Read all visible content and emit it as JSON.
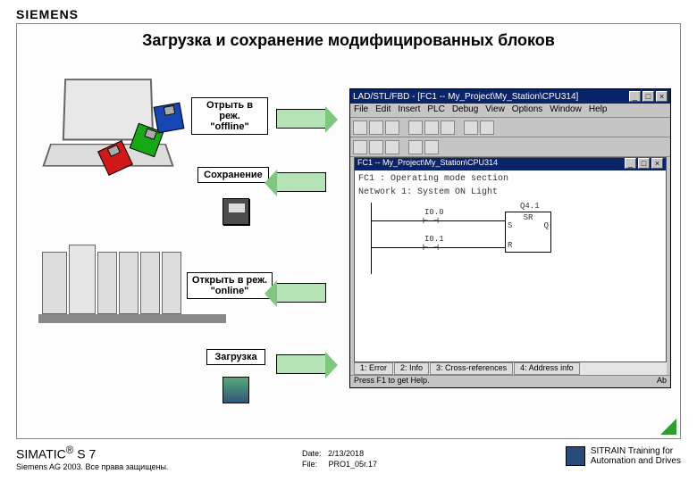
{
  "brand": "SIEMENS",
  "title": "Загрузка и сохранение модифицированных блоков",
  "labels": {
    "open_offline": "Отрыть в реж.\n\"offline\"",
    "save": "Сохранение",
    "open_online": "Открыть в реж.\n\"online\"",
    "download": "Загрузка"
  },
  "editor": {
    "title": "LAD/STL/FBD - [FC1 -- My_Project\\My_Station\\CPU314]",
    "menu": [
      "File",
      "Edit",
      "Insert",
      "PLC",
      "Debug",
      "View",
      "Options",
      "Window",
      "Help"
    ],
    "inner_title": "FC1 -- My_Project\\My_Station\\CPU314",
    "comment1": "FC1 : Operating mode section",
    "comment2": "Network 1: System ON Light",
    "io": {
      "in0": "I0.0",
      "in1": "I0.1",
      "out": "Q4.1",
      "block": "SR",
      "s": "S",
      "r": "R",
      "q": "Q"
    },
    "tabs": [
      "1: Error",
      "2: Info",
      "3: Cross-references",
      "4: Address info"
    ],
    "status": "Press F1 to get Help.",
    "status_right": "Ab"
  },
  "footer": {
    "product": "SIMATIC",
    "reg": "®",
    "suffix": " S 7",
    "copyright": "Siemens AG 2003. Все права защищены.",
    "date_lbl": "Date:",
    "date": "2/13/2018",
    "file_lbl": "File:",
    "file": "PRO1_05r.17",
    "sitrain1": "SITRAIN Training for",
    "sitrain2": "Automation and Drives"
  }
}
